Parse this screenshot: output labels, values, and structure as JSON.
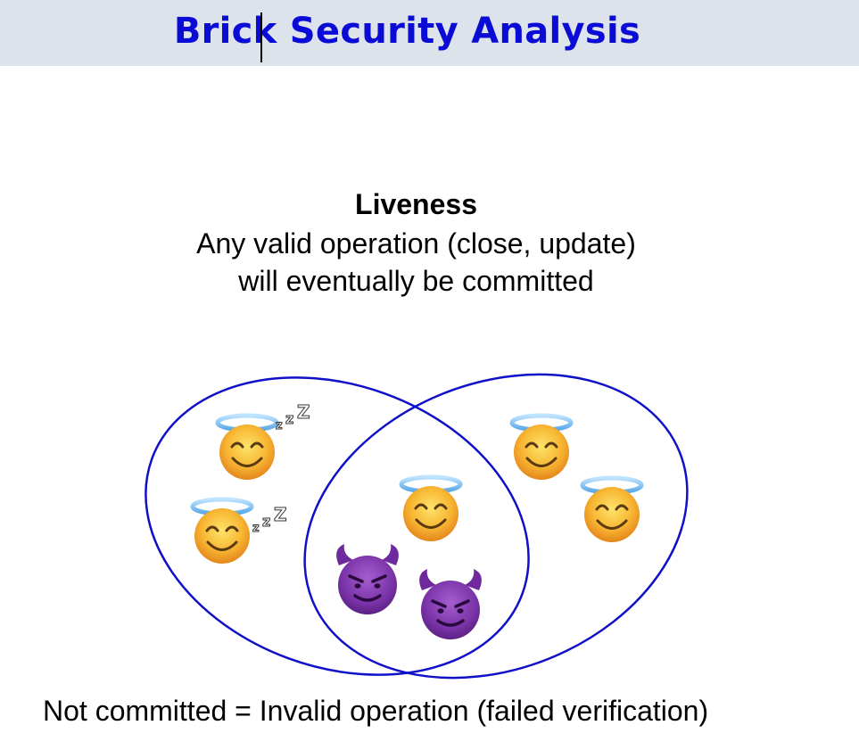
{
  "header": {
    "title": "Brick Security Analysis",
    "band_color": "#dde3ea",
    "title_color": "#0b0bd6"
  },
  "main": {
    "heading": "Liveness",
    "line1": "Any valid operation (close, update)",
    "line2": "will eventually be committed"
  },
  "diagram": {
    "outline_color": "#1010c8",
    "sets": [
      {
        "name": "left-set",
        "members": [
          "sleeping-angel",
          "sleeping-angel"
        ]
      },
      {
        "name": "intersection",
        "members": [
          "angel",
          "devil",
          "devil"
        ]
      },
      {
        "name": "right-set",
        "members": [
          "angel",
          "angel"
        ]
      }
    ],
    "icons": [
      "smiling-face-with-halo-icon",
      "sleeping-zzz-icon",
      "smiling-devil-icon"
    ],
    "sleep_glyph": "zZZ"
  },
  "footer": {
    "text": "Not committed = Invalid operation (failed verification)"
  }
}
